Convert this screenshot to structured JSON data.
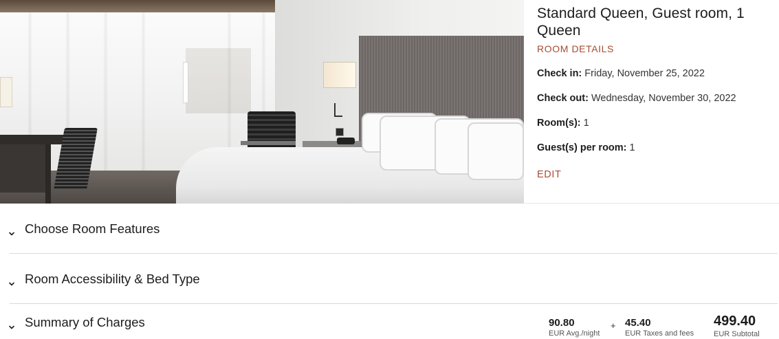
{
  "room": {
    "title": "Standard Queen, Guest room, 1 Queen",
    "details_link": "ROOM DETAILS",
    "check_in_label": "Check in:",
    "check_in_value": "Friday, November 25, 2022",
    "check_out_label": "Check out:",
    "check_out_value": "Wednesday, November 30, 2022",
    "rooms_label": "Room(s):",
    "rooms_value": "1",
    "guests_label": "Guest(s) per room:",
    "guests_value": "1",
    "edit_link": "EDIT"
  },
  "sections": {
    "features": {
      "title": "Choose Room Features",
      "icon": "chevron-down-icon"
    },
    "accessibility": {
      "title": "Room Accessibility & Bed Type",
      "icon": "chevron-down-icon"
    },
    "summary": {
      "title": "Summary of Charges",
      "icon": "chevron-down-icon"
    }
  },
  "charges": {
    "avg_night_amount": "90.80",
    "avg_night_label": "EUR Avg./night",
    "plus_sign": "+",
    "taxes_amount": "45.40",
    "taxes_label": "EUR Taxes and fees",
    "subtotal_amount": "499.40",
    "subtotal_label": "EUR Subtotal"
  },
  "colors": {
    "accent": "#a54d30",
    "text": "#1c1c1c",
    "divider": "#d9d9d9"
  }
}
